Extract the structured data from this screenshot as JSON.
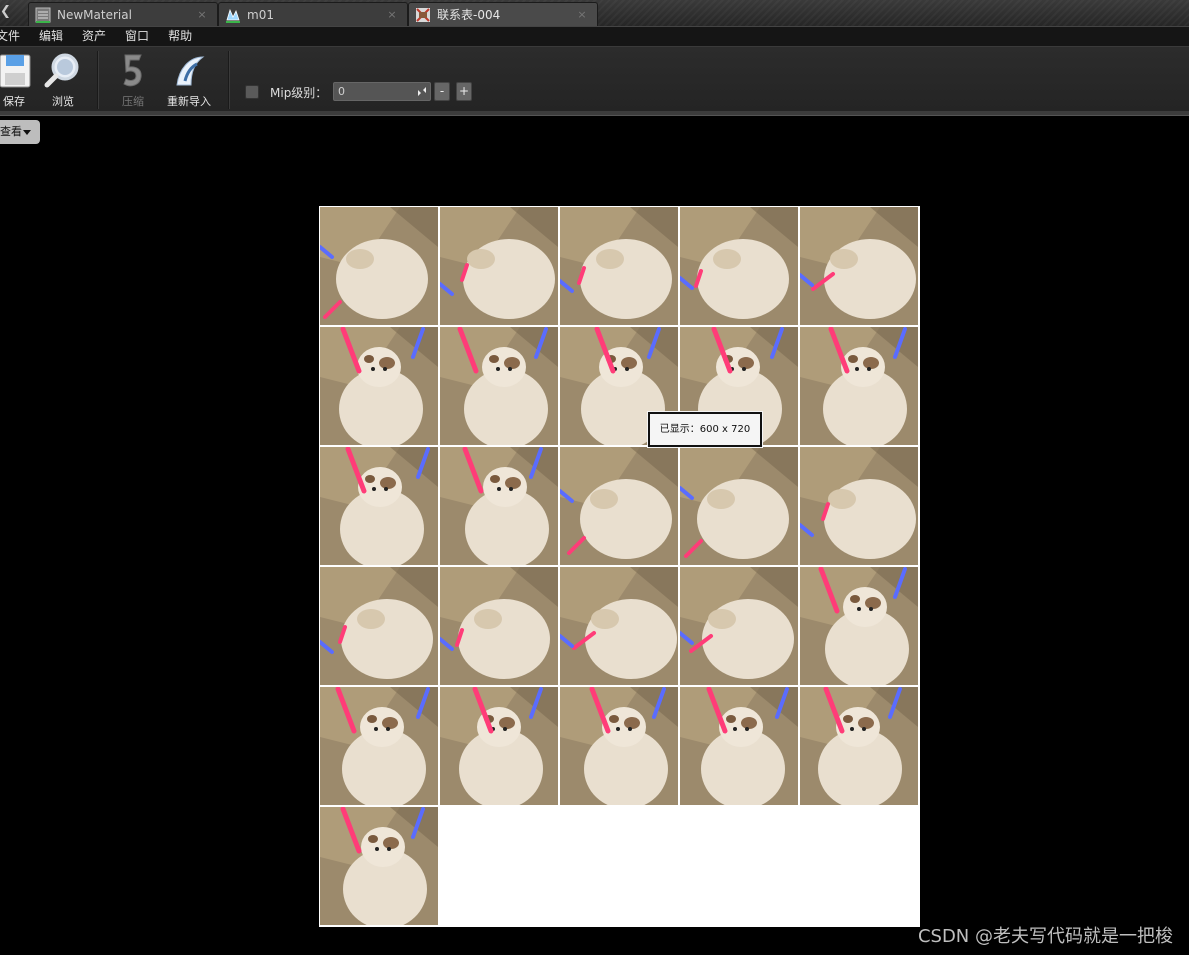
{
  "tabs": [
    {
      "label": "NewMaterial",
      "icon": "material-icon",
      "close": "×"
    },
    {
      "label": "m01",
      "icon": "static-mesh-icon",
      "close": "×"
    },
    {
      "label": "联系表-004",
      "icon": "texture-icon",
      "close": "×"
    }
  ],
  "menu": [
    "文件",
    "编辑",
    "资产",
    "窗口",
    "帮助"
  ],
  "toolbar": {
    "save_label": "保存",
    "browse_label": "浏览",
    "compress_label": "压缩",
    "reimport_label": "重新导入",
    "mip_label": "Mip级别：",
    "mip_value": "0",
    "minus_label": "-",
    "plus_label": "+"
  },
  "viewport": {
    "view_button_label": "查看",
    "tooltip": "已显示：600 x 720",
    "grid": {
      "columns": 5,
      "rows": 6,
      "filled_cells": 26
    }
  },
  "watermark": "CSDN @老夫写代码就是一把梭",
  "colors": {
    "tab_active": "#4a4a4a",
    "toolbar_bg": "#2c2c2c",
    "viewport_bg": "#000000",
    "texture_bg": "#ffffff",
    "saber_red": "#ff3c78",
    "saber_blue": "#5a6cff",
    "cat_fur": "#e9dfcf",
    "wall": "#9c8a6c"
  }
}
